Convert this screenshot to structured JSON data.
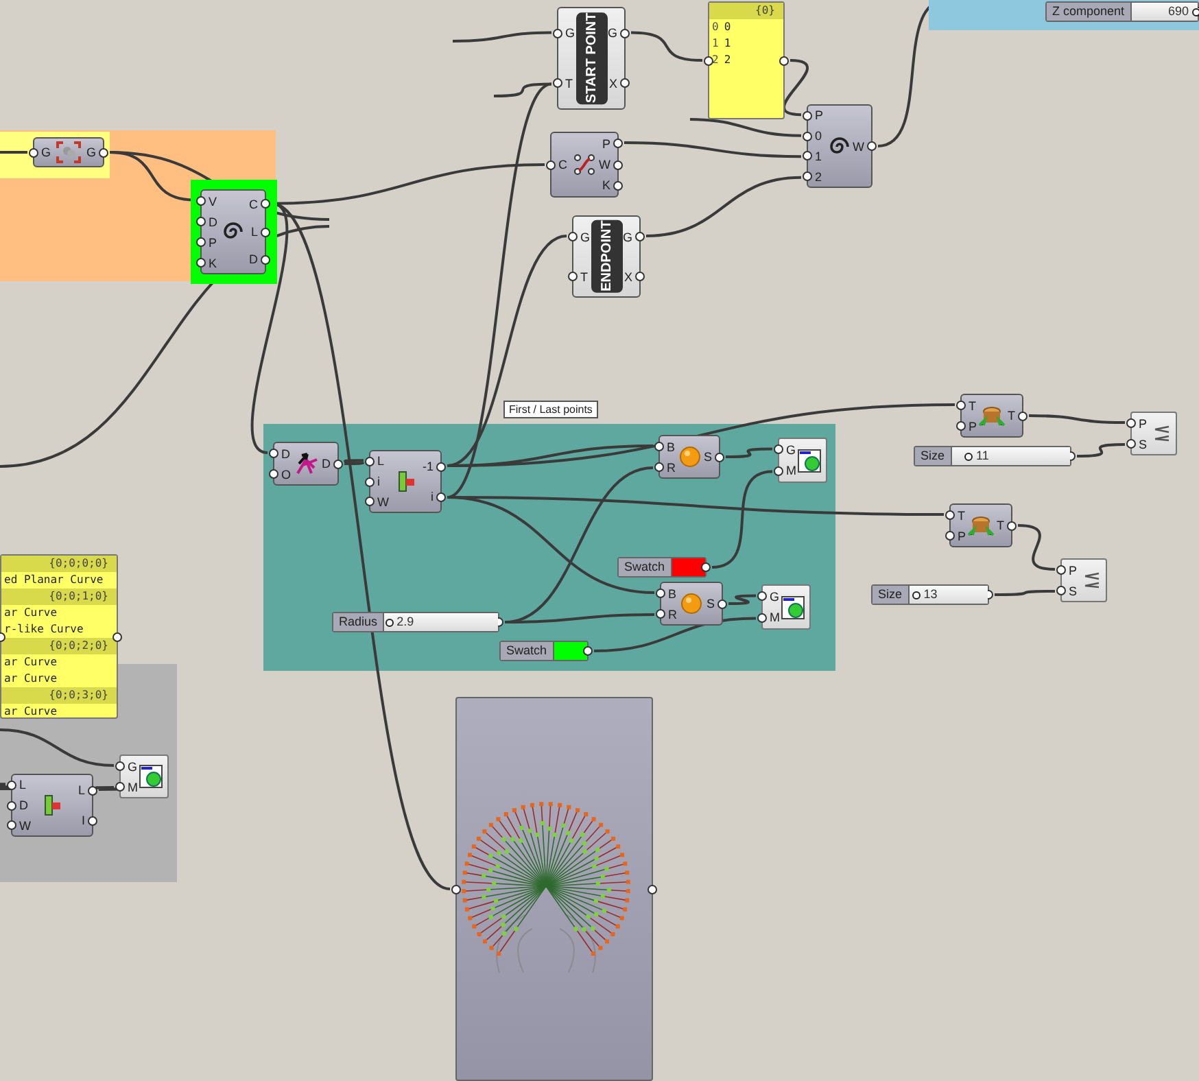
{
  "canvas": {
    "groups": [
      {
        "kind": "group",
        "color": "#ffbf80"
      },
      {
        "kind": "group",
        "color": "#ffff80"
      },
      {
        "kind": "group",
        "color": "#00ff00"
      },
      {
        "kind": "group",
        "color": "#5fa8a0"
      },
      {
        "kind": "group",
        "color": "#b3b3b3"
      },
      {
        "kind": "group",
        "color": "#8ec8df"
      }
    ],
    "components": [
      {
        "kind": "labelled",
        "label": "START POINT",
        "inputs": [
          "G",
          "T"
        ],
        "outputs": [
          "G",
          "X"
        ]
      },
      {
        "kind": "panel",
        "rows": [
          {
            "kind": "path",
            "text": "{0}"
          },
          {
            "kind": "item",
            "index": "0",
            "text": "0"
          },
          {
            "kind": "item",
            "index": "1",
            "text": "1"
          },
          {
            "kind": "item",
            "index": "2",
            "text": "2"
          }
        ]
      },
      {
        "kind": "component",
        "inputs": [
          "C"
        ],
        "outputs": [
          "P",
          "W",
          "K"
        ]
      },
      {
        "kind": "labelled",
        "label": "ENDPOINT",
        "inputs": [
          "G",
          "T"
        ],
        "outputs": [
          "G",
          "X"
        ]
      },
      {
        "kind": "component",
        "inputs": [
          "P",
          "0",
          "1",
          "2"
        ],
        "outputs": [
          "W"
        ]
      },
      {
        "kind": "slider",
        "label": "Z component",
        "value": "690",
        "level": 0.97
      },
      {
        "kind": "component",
        "inputs": [
          "G"
        ],
        "outputs": [
          "G"
        ]
      },
      {
        "kind": "component",
        "inputs": [
          "V",
          "D",
          "P",
          "K"
        ],
        "outputs": [
          "C",
          "L",
          "D"
        ]
      },
      {
        "kind": "component",
        "inputs": [
          "D",
          "O"
        ],
        "outputs": [
          "D"
        ]
      },
      {
        "kind": "component",
        "inputs": [
          "L",
          "i",
          "W"
        ],
        "outputs": [
          "-1",
          "i"
        ]
      },
      {
        "kind": "component",
        "inputs": [
          "B",
          "R"
        ],
        "outputs": [
          "S"
        ]
      },
      {
        "kind": "preview",
        "inputs": [
          "G",
          "M"
        ]
      },
      {
        "kind": "swatch",
        "label": "Swatch",
        "color": "#ff0000"
      },
      {
        "kind": "component",
        "inputs": [
          "B",
          "R"
        ],
        "outputs": [
          "S"
        ]
      },
      {
        "kind": "preview",
        "inputs": [
          "G",
          "M"
        ]
      },
      {
        "kind": "slider",
        "label": "Radius",
        "value": "2.9",
        "level": 0.05
      },
      {
        "kind": "swatch",
        "label": "Swatch",
        "color": "#00ff00"
      },
      {
        "kind": "component",
        "inputs": [
          "T",
          "P"
        ],
        "outputs": [
          "T"
        ]
      },
      {
        "kind": "slider",
        "label": "Size",
        "value": "11",
        "level": 0.15
      },
      {
        "kind": "tag",
        "inputs": [
          "P",
          "S"
        ]
      },
      {
        "kind": "component",
        "inputs": [
          "T",
          "P"
        ],
        "outputs": [
          "T"
        ]
      },
      {
        "kind": "slider",
        "label": "Size",
        "value": "13",
        "level": 0.1
      },
      {
        "kind": "tag",
        "inputs": [
          "P",
          "S"
        ]
      },
      {
        "kind": "panel",
        "rows": [
          {
            "kind": "path",
            "text": "{0;0;0;0}"
          },
          {
            "kind": "item",
            "text": "ed Planar Curve"
          },
          {
            "kind": "path",
            "text": "{0;0;1;0}"
          },
          {
            "kind": "item",
            "text": "ar Curve"
          },
          {
            "kind": "item",
            "text": "r-like Curve"
          },
          {
            "kind": "path",
            "text": "{0;0;2;0}"
          },
          {
            "kind": "item",
            "text": "ar Curve"
          },
          {
            "kind": "item",
            "text": "ar Curve"
          },
          {
            "kind": "path",
            "text": "{0;0;3;0}"
          },
          {
            "kind": "item",
            "text": "ar Curve"
          }
        ]
      },
      {
        "kind": "component",
        "inputs": [
          "L",
          "D",
          "W"
        ],
        "outputs": [
          "L",
          "I"
        ]
      },
      {
        "kind": "preview",
        "inputs": [
          "G",
          "M"
        ]
      },
      {
        "kind": "viewer"
      }
    ],
    "tooltip": {
      "text": "First / Last points"
    }
  }
}
